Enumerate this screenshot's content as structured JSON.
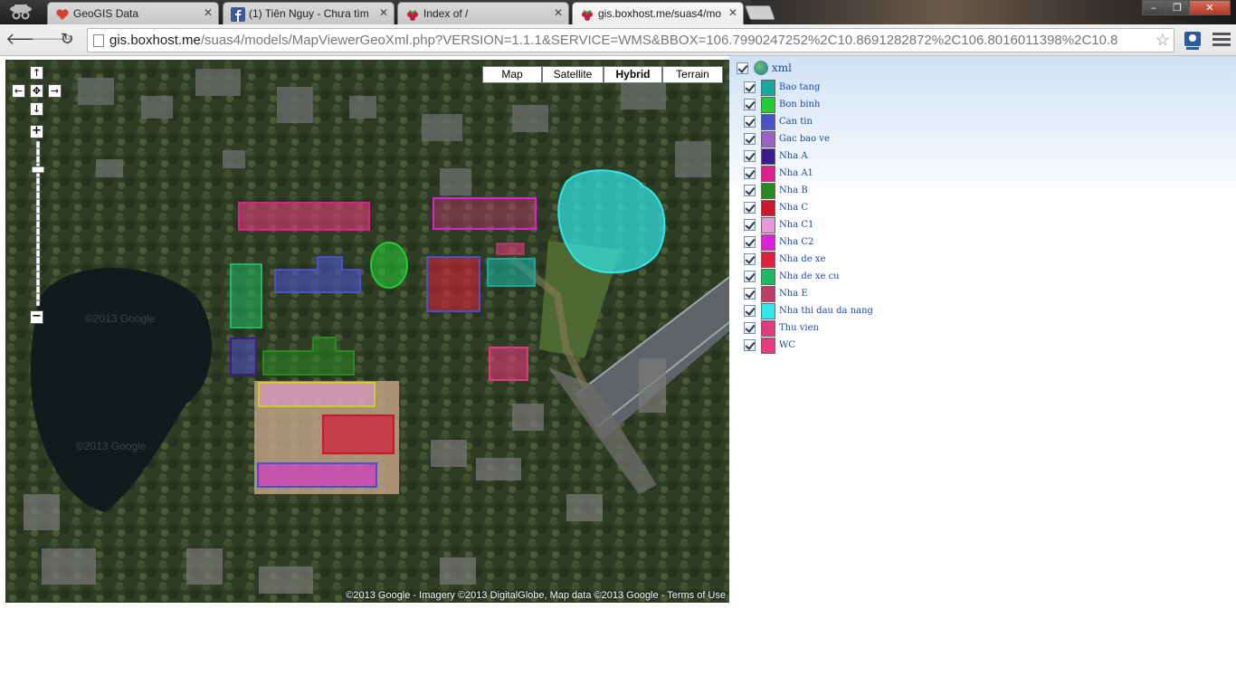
{
  "browser": {
    "tabs": [
      {
        "title": "GeoGIS Data",
        "favicon": "heart-icon",
        "active": false
      },
      {
        "title": "(1) Tiên Nguy - Chưa tìm",
        "favicon": "facebook-icon",
        "active": false
      },
      {
        "title": "Index of /",
        "favicon": "raspberry-icon",
        "active": false
      },
      {
        "title": "gis.boxhost.me/suas4/mo",
        "favicon": "raspberry-icon",
        "active": true
      }
    ],
    "url_host": "gis.boxhost.me",
    "url_path": "/suas4/models/MapViewerGeoXml.php?VERSION=1.1.1&SERVICE=WMS&BBOX=106.7990247252%2C10.8691282872%2C106.8016011398%2C10.8",
    "window_buttons": {
      "minimize": "–",
      "maximize": "❐",
      "close": "✕"
    }
  },
  "map": {
    "types": [
      "Map",
      "Satellite",
      "Hybrid",
      "Terrain"
    ],
    "selected_type": "Hybrid",
    "copyright": "©2013 Google - Imagery ©2013 DigitalGlobe, Map data ©2013 Google - Terms of Use",
    "watermark_1": "©2013 Google",
    "watermark_2": "©2013 Google"
  },
  "layers": {
    "root": "xml",
    "items": [
      {
        "label": "Bao tang",
        "color": "#1aa89a"
      },
      {
        "label": "Bon binh",
        "color": "#22cc33"
      },
      {
        "label": "Can tin",
        "color": "#4a52c8"
      },
      {
        "label": "Gac bao ve",
        "color": "#9c5fc6"
      },
      {
        "label": "Nha A",
        "color": "#3b1a8c"
      },
      {
        "label": "Nha A1",
        "color": "#e0208a"
      },
      {
        "label": "Nha B",
        "color": "#2a8a22"
      },
      {
        "label": "Nha C",
        "color": "#d0152c"
      },
      {
        "label": "Nha C1",
        "color": "#e49ad8"
      },
      {
        "label": "Nha C2",
        "color": "#e020d8"
      },
      {
        "label": "Nha de xe",
        "color": "#e0203c"
      },
      {
        "label": "Nha de xe cu",
        "color": "#20b860"
      },
      {
        "label": "Nha E",
        "color": "#c03a6a"
      },
      {
        "label": "Nha thi dau da nang",
        "color": "#30e8e8"
      },
      {
        "label": "Thu vien",
        "color": "#e03a7a"
      },
      {
        "label": "WC",
        "color": "#e83a7c"
      }
    ]
  }
}
